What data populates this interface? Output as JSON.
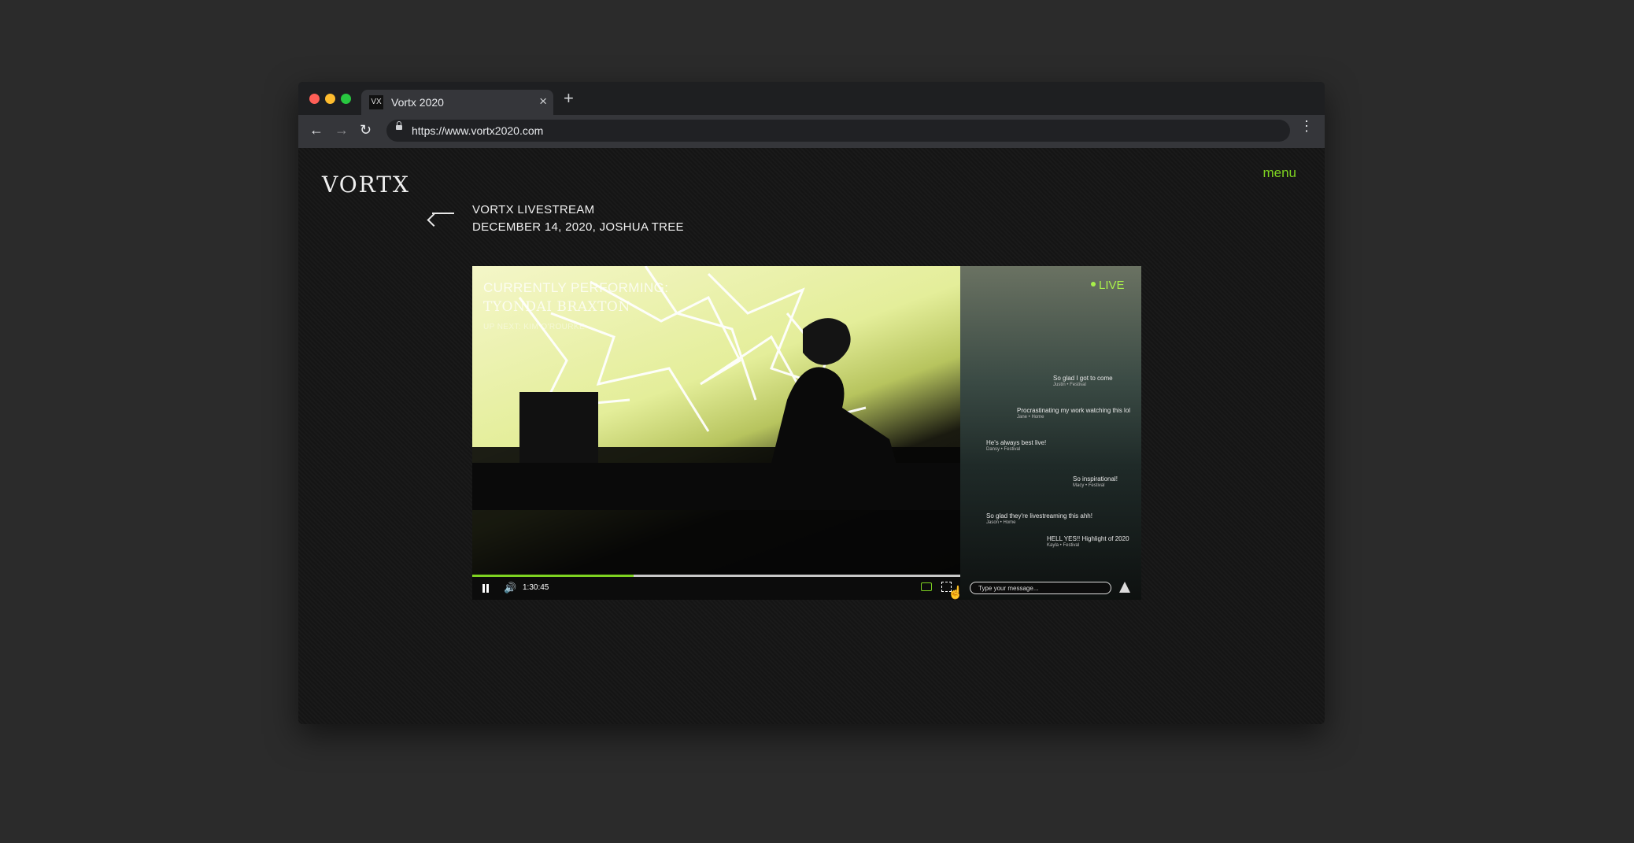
{
  "browser": {
    "tab_title": "Vortx 2020",
    "tab_favicon": "VX",
    "close_glyph": "×",
    "new_tab_glyph": "+",
    "url": "https://www.vortx2020.com",
    "back_glyph": "←",
    "forward_glyph": "→",
    "reload_glyph": "↻",
    "menu_glyph": "⋮"
  },
  "site": {
    "logo": "VORTX",
    "menu_label": "menu"
  },
  "event": {
    "title": "VORTX LIVESTREAM",
    "subtitle": "DECEMBER 14, 2020, JOSHUA TREE"
  },
  "player": {
    "performing_label": "CURRENTLY PERFORMING:",
    "performer": "TYONDAI BRAXTON",
    "up_next": "UP NEXT: KIM O'ROURKE",
    "live_label": "LIVE",
    "time": "1:30:45",
    "progress": 0.33,
    "volume_glyph": "🔊",
    "cursor_glyph": "☝",
    "accent_color": "#7ed321",
    "live_color": "#a8f04a"
  },
  "chat": {
    "messages": [
      {
        "text": "So glad I got to come",
        "user": "Justin • Festival"
      },
      {
        "text": "Procrastinating my work watching this lol",
        "user": "Jane • Home"
      },
      {
        "text": "He's always best live!",
        "user": "Dansy • Festival"
      },
      {
        "text": "So inspirational!",
        "user": "Macy • Festival"
      },
      {
        "text": "So glad they're livestreaming this ahh!",
        "user": "Jason • Home"
      },
      {
        "text": "HELL YES!! Highlight of 2020",
        "user": "Kayla • Festival"
      }
    ],
    "input_placeholder": "Type your message..."
  }
}
